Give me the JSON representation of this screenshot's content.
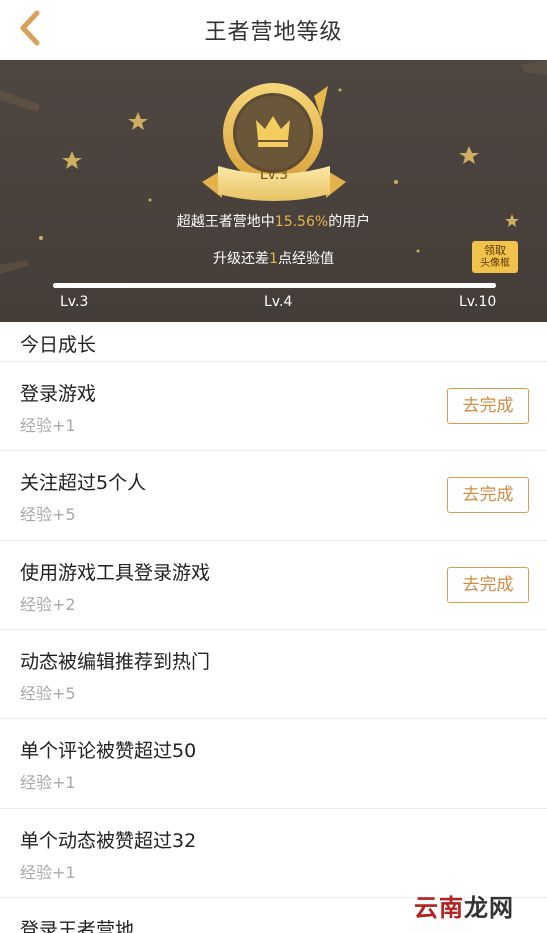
{
  "header": {
    "title": "王者营地等级",
    "back_icon": "chevron-left-icon"
  },
  "banner": {
    "badge_level": "Lv.3",
    "rank_prefix": "超越王者营地中",
    "rank_percent": "15.56%",
    "rank_suffix": "的用户",
    "upgrade_prefix": "升级还差",
    "upgrade_points": "1",
    "upgrade_suffix": "点经验值",
    "claim_line1": "领取",
    "claim_line2": "头像框",
    "progress_fraction": 1.0,
    "level_current": "Lv.3",
    "level_next": "Lv.4",
    "level_max": "Lv.10"
  },
  "section": {
    "title": "今日成长"
  },
  "tasks": [
    {
      "name": "登录游戏",
      "exp": "经验+1",
      "button": "去完成"
    },
    {
      "name": "关注超过5个人",
      "exp": "经验+5",
      "button": "去完成"
    },
    {
      "name": "使用游戏工具登录游戏",
      "exp": "经验+2",
      "button": "去完成"
    },
    {
      "name": "动态被编辑推荐到热门",
      "exp": "经验+5",
      "button": ""
    },
    {
      "name": "单个评论被赞超过50",
      "exp": "经验+1",
      "button": ""
    },
    {
      "name": "单个动态被赞超过32",
      "exp": "经验+1",
      "button": ""
    },
    {
      "name": "登录王者营地",
      "exp": "",
      "button": ""
    }
  ],
  "watermark": {
    "part1": "云南",
    "part2": "龙网"
  },
  "colors": {
    "accent": "#e7b548",
    "button_border": "#d99a55",
    "banner_bg": "#4a423d"
  }
}
